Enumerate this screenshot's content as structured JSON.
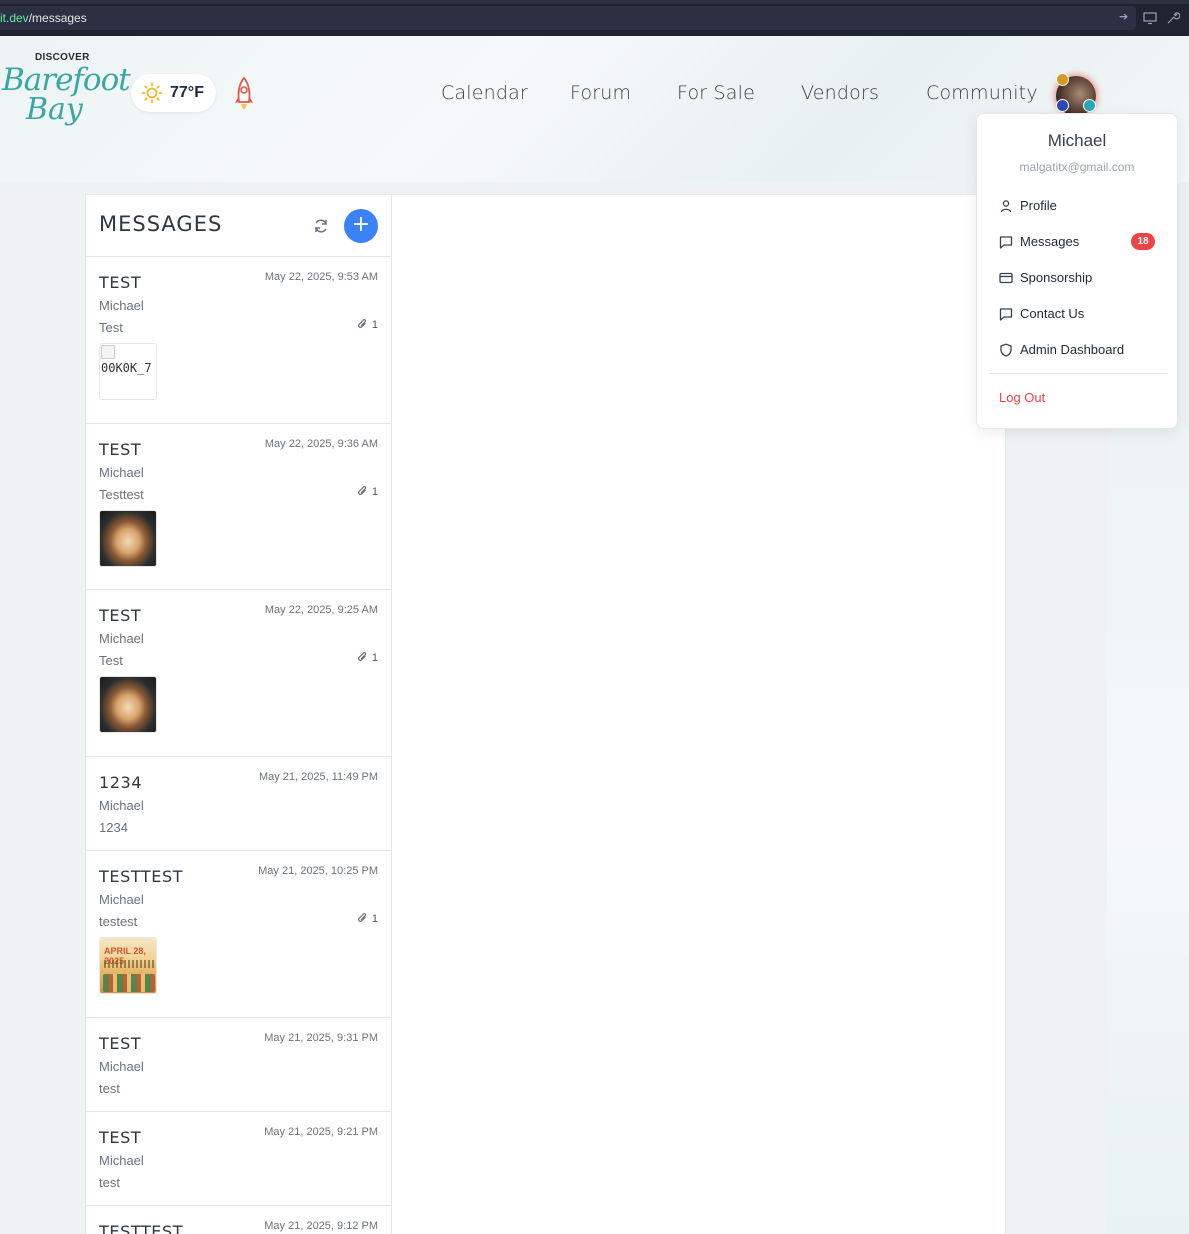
{
  "browser": {
    "url_domain": "it.dev",
    "url_path": "/messages"
  },
  "header": {
    "logo": {
      "small": "DISCOVER",
      "line1": "Barefoot",
      "line2": "Bay"
    },
    "weather": {
      "icon": "sun-icon",
      "temp": "77°F"
    },
    "nav": [
      "Calendar",
      "Forum",
      "For Sale",
      "Vendors",
      "Community"
    ]
  },
  "messages_panel": {
    "title": "MESSAGES",
    "items": [
      {
        "subject": "TEST",
        "date": "May 22, 2025, 9:53 AM",
        "from": "Michael",
        "body": "Test",
        "attachments": "1",
        "thumb_text": "00K0K_7"
      },
      {
        "subject": "TEST",
        "date": "May 22, 2025, 9:36 AM",
        "from": "Michael",
        "body": "Testtest",
        "attachments": "1"
      },
      {
        "subject": "TEST",
        "date": "May 22, 2025, 9:25 AM",
        "from": "Michael",
        "body": "Test",
        "attachments": "1"
      },
      {
        "subject": "1234",
        "date": "May 21, 2025, 11:49 PM",
        "from": "Michael",
        "body": "1234"
      },
      {
        "subject": "TESTTEST",
        "date": "May 21, 2025, 10:25 PM",
        "from": "Michael",
        "body": "testest",
        "attachments": "1",
        "poster_top": "APRIL 28, 2025"
      },
      {
        "subject": "TEST",
        "date": "May 21, 2025, 9:31 PM",
        "from": "Michael",
        "body": "test"
      },
      {
        "subject": "TEST",
        "date": "May 21, 2025, 9:21 PM",
        "from": "Michael",
        "body": "test"
      },
      {
        "subject": "TESTTEST",
        "date": "May 21, 2025, 9:12 PM"
      }
    ]
  },
  "user_menu": {
    "name": "Michael",
    "email": "malgatitx@gmail.com",
    "items": [
      {
        "label": "Profile",
        "icon": "user-icon"
      },
      {
        "label": "Messages",
        "icon": "chat-icon",
        "badge": "18"
      },
      {
        "label": "Sponsorship",
        "icon": "card-icon"
      },
      {
        "label": "Contact Us",
        "icon": "chat-icon"
      },
      {
        "label": "Admin Dashboard",
        "icon": "shield-icon"
      }
    ],
    "logout": "Log Out"
  },
  "colors": {
    "accent": "#3b82f6",
    "badge": "#ef4444",
    "logo": "#3aa7a0"
  }
}
